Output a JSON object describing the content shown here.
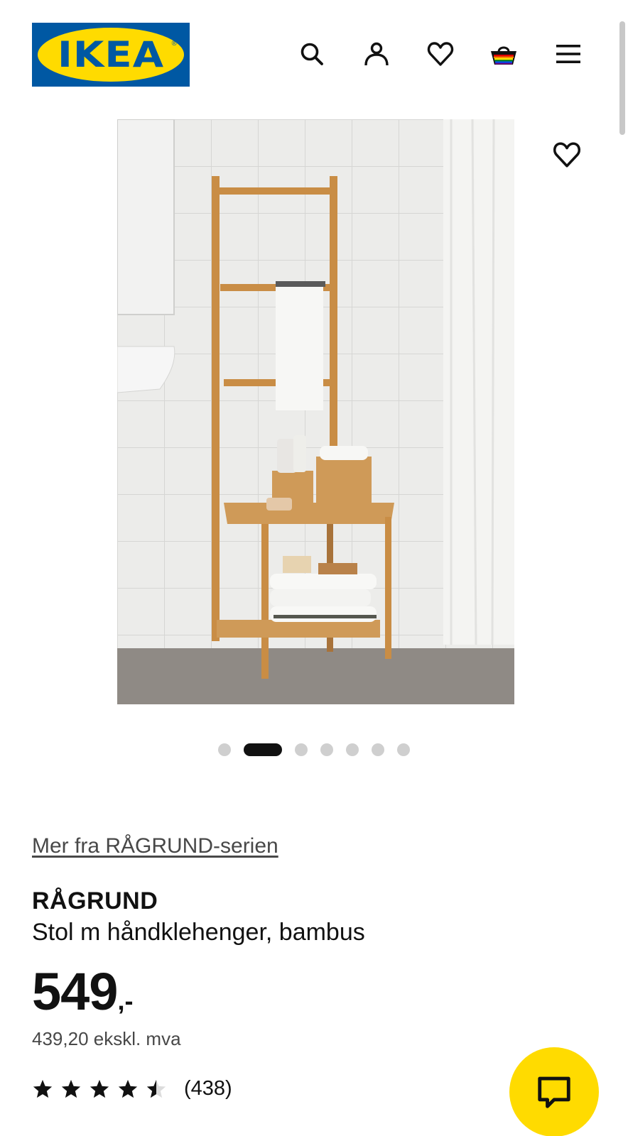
{
  "header": {
    "logo_text": "IKEA",
    "logo_reg": "®",
    "icons": [
      "search-icon",
      "account-icon",
      "heart-icon",
      "basket-icon",
      "menu-icon"
    ]
  },
  "product": {
    "series_link": "Mer fra RÅGRUND-serien",
    "name": "RÅGRUND",
    "description": "Stol m håndklehenger, bambus",
    "price_integer": "549",
    "price_suffix": ",-",
    "price_ex_vat": "439,20 ekskl. mva",
    "rating_value": 4.5,
    "rating_count": "(438)"
  },
  "carousel": {
    "total": 7,
    "active_index": 1
  },
  "colors": {
    "ikea_blue": "#0058a3",
    "ikea_yellow": "#ffdb00",
    "text_primary": "#111111",
    "text_secondary": "#484848"
  }
}
